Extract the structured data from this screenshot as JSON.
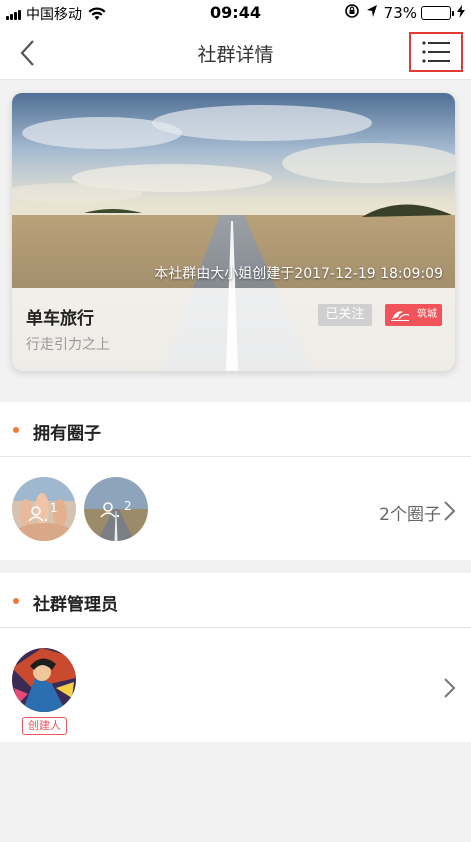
{
  "status_bar": {
    "carrier": "中国移动",
    "time": "09:44",
    "battery": "73%",
    "battery_level": 0.73
  },
  "nav": {
    "title": "社群详情",
    "back_icon": "chevron-left-icon",
    "menu_icon": "list-menu-icon"
  },
  "group": {
    "name": "单车旅行",
    "slogan": "行走引力之上",
    "created_info": "本社群由大小姐创建于2017-12-19 18:09:09",
    "follow_status": "已关注",
    "city_badge": "筑城"
  },
  "circles_section": {
    "title": "拥有圈子",
    "count_label": "2个圈子",
    "items": [
      {
        "members": "1"
      },
      {
        "members": "2"
      }
    ]
  },
  "admins_section": {
    "title": "社群管理员",
    "creator_tag": "创建人"
  },
  "colors": {
    "accent_orange": "#f27935",
    "badge_red": "#f0535a",
    "highlight_border": "#e53935"
  }
}
